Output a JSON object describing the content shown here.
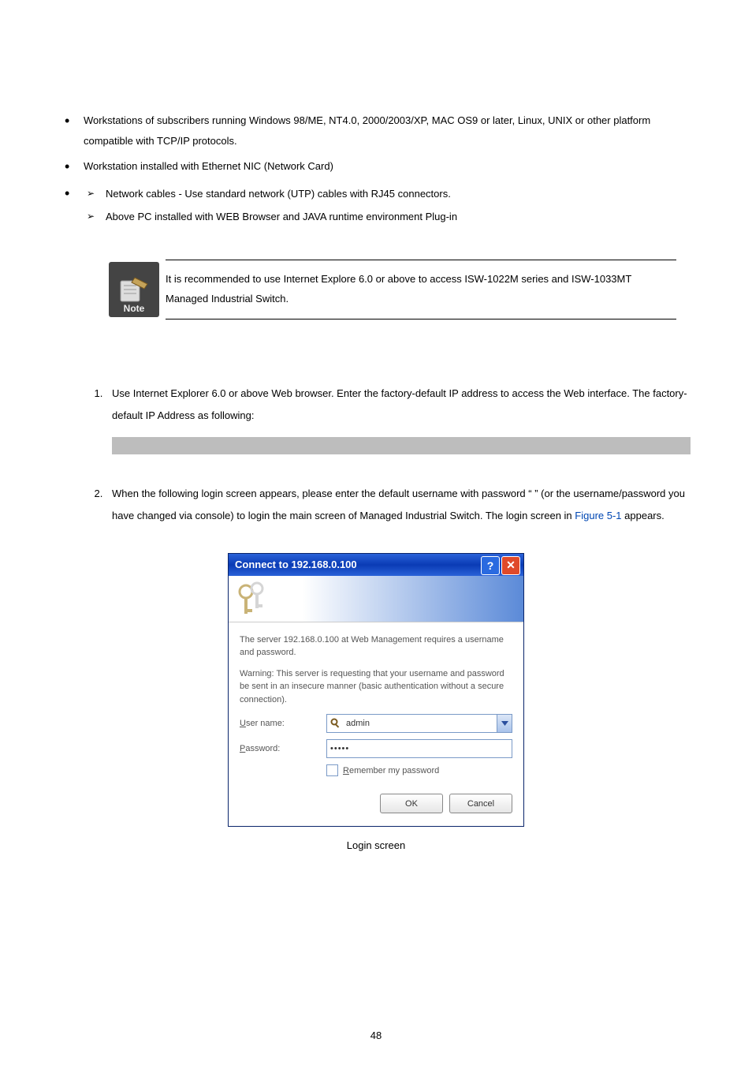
{
  "bullets": {
    "b1": "Workstations of subscribers running Windows 98/ME, NT4.0, 2000/2003/XP, MAC OS9 or later, Linux, UNIX or other platform compatible with TCP/IP protocols.",
    "b2": "Workstation installed with Ethernet NIC (Network Card)",
    "sub1": "Network cables - Use standard network (UTP) cables with RJ45 connectors.",
    "sub2": "Above PC installed with WEB Browser and JAVA runtime environment Plug-in"
  },
  "note": {
    "label": "Note",
    "text": "It is recommended to use Internet Explore 6.0 or above to access ISW-1022M series and ISW-1033MT Managed Industrial Switch."
  },
  "steps": {
    "s1": "Use Internet Explorer 6.0 or above Web browser. Enter the factory-default IP address to access the Web interface. The factory-default IP Address as following:",
    "s2a": "When the following login screen appears, please enter the default username ",
    "s2b": " with password “ ",
    "s2c": " ” (or the username/password you have changed via console) to login the main screen of Managed Industrial Switch. The login screen in ",
    "figref": "Figure 5-1",
    "s2d": " appears."
  },
  "dialog": {
    "title": "Connect to 192.168.0.100",
    "help": "?",
    "close": "✕",
    "msg1": "The server 192.168.0.100 at Web Management requires a username and password.",
    "msg2": "Warning: This server is requesting that your username and password be sent in an insecure manner (basic authentication without a secure connection).",
    "user_lbl_pre": "U",
    "user_lbl_rest": "ser name:",
    "user_val": "admin",
    "pass_lbl_pre": "P",
    "pass_lbl_rest": "assword:",
    "pass_val": "•••••",
    "remember_pre": "R",
    "remember_rest": "emember my password",
    "ok": "OK",
    "cancel": "Cancel"
  },
  "caption": "Login screen",
  "page_no": "48"
}
